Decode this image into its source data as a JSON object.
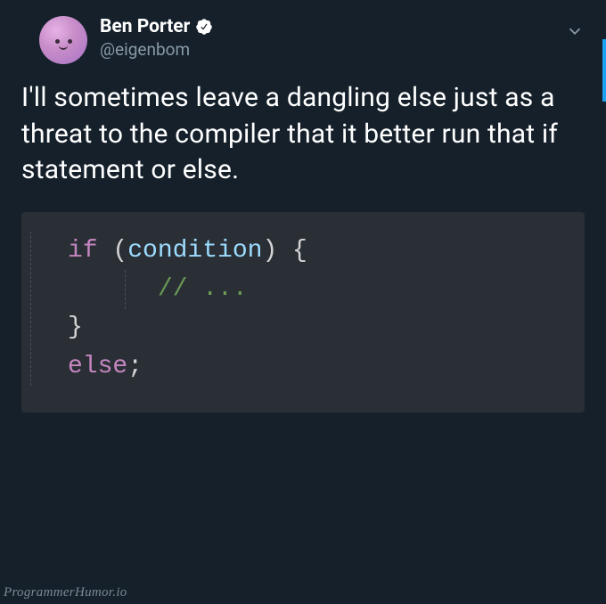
{
  "header": {
    "display_name": "Ben Porter",
    "handle": "@eigenbom"
  },
  "body": "I'll sometimes leave a dangling else just as a threat to the compiler that it better run that if statement or else.",
  "code": {
    "kw_if": "if",
    "open_paren": " (",
    "condition": "condition",
    "close_paren_brace": ") {",
    "indent": "      ",
    "comment": "// ...",
    "close_brace": "}",
    "kw_else": "else",
    "semicolon": ";"
  },
  "watermark": "ProgrammerHumor.io"
}
